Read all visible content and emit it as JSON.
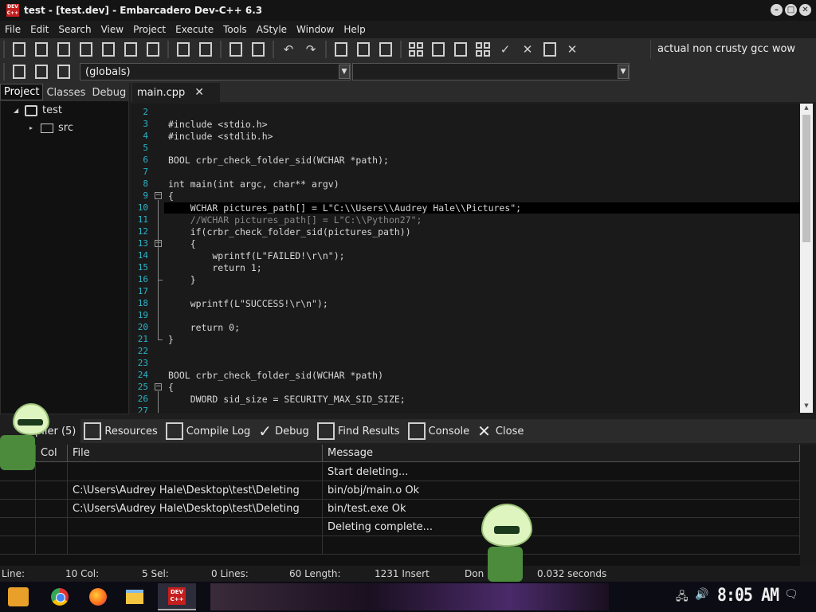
{
  "window": {
    "title": "test - [test.dev] - Embarcadero Dev-C++ 6.3",
    "app_icon_text": "DEV C++",
    "min": "–",
    "max": "□",
    "close": "✕"
  },
  "menu": [
    "File",
    "Edit",
    "Search",
    "View",
    "Project",
    "Execute",
    "Tools",
    "AStyle",
    "Window",
    "Help"
  ],
  "toolbar": {
    "compiler": "actual non crusty gcc wow",
    "scope_combo": "(globals)",
    "undo_glyph": "↶",
    "redo_glyph": "↷",
    "check_glyph": "✓",
    "cross_glyph": "✕"
  },
  "left_panel": {
    "tabs": [
      "Project",
      "Classes",
      "Debug"
    ],
    "tree": [
      {
        "label": "test",
        "toggle": "◢",
        "icon": "project-icon"
      },
      {
        "label": "src",
        "toggle": "▸",
        "icon": "folder-icon"
      }
    ]
  },
  "editor": {
    "tab_label": "main.cpp",
    "tab_close": "✕",
    "lines": [
      {
        "no": "2",
        "text": ""
      },
      {
        "no": "3",
        "text": "#include <stdio.h>"
      },
      {
        "no": "4",
        "text": "#include <stdlib.h>"
      },
      {
        "no": "5",
        "text": ""
      },
      {
        "no": "6",
        "text": "BOOL crbr_check_folder_sid(WCHAR *path);"
      },
      {
        "no": "7",
        "text": ""
      },
      {
        "no": "8",
        "text": "int main(int argc, char** argv)"
      },
      {
        "no": "9",
        "text": "{"
      },
      {
        "no": "10",
        "text": "    WCHAR pictures_path[] = L\"C:\\\\Users\\\\Audrey Hale\\\\Pictures\";"
      },
      {
        "no": "11",
        "text": "    //WCHAR pictures_path[] = L\"C:\\\\Python27\";"
      },
      {
        "no": "12",
        "text": "    if(crbr_check_folder_sid(pictures_path))"
      },
      {
        "no": "13",
        "text": "    {"
      },
      {
        "no": "14",
        "text": "        wprintf(L\"FAILED!\\r\\n\");"
      },
      {
        "no": "15",
        "text": "        return 1;"
      },
      {
        "no": "16",
        "text": "    }"
      },
      {
        "no": "17",
        "text": ""
      },
      {
        "no": "18",
        "text": "    wprintf(L\"SUCCESS!\\r\\n\");"
      },
      {
        "no": "19",
        "text": ""
      },
      {
        "no": "20",
        "text": "    return 0;"
      },
      {
        "no": "21",
        "text": "}"
      },
      {
        "no": "22",
        "text": ""
      },
      {
        "no": "23",
        "text": ""
      },
      {
        "no": "24",
        "text": "BOOL crbr_check_folder_sid(WCHAR *path)"
      },
      {
        "no": "25",
        "text": "{"
      },
      {
        "no": "26",
        "text": "    DWORD sid_size = SECURITY_MAX_SID_SIZE;"
      },
      {
        "no": "27",
        "text": ""
      }
    ],
    "fold_marker": "−"
  },
  "bottom_tabs": [
    "piler (5)",
    "Resources",
    "Compile Log",
    "Debug",
    "Find Results",
    "Console",
    "Close"
  ],
  "messages": {
    "headers": [
      "Col",
      "File",
      "Message"
    ],
    "rows": [
      {
        "file": "",
        "message": "Start deleting..."
      },
      {
        "file": "C:\\Users\\Audrey Hale\\Desktop\\test\\Deleting",
        "message": "bin/obj/main.o Ok"
      },
      {
        "file": "C:\\Users\\Audrey Hale\\Desktop\\test\\Deleting",
        "message": "bin/test.exe Ok"
      },
      {
        "file": "",
        "message": "Deleting complete..."
      }
    ]
  },
  "status": {
    "line_label": "Line:",
    "col_label": "10 Col:",
    "sel_label": "5 Sel:",
    "lines_label": "0 Lines:",
    "length_label": "60 Length:",
    "insert_label": "1231 Insert",
    "done_label": "Don",
    "time": "0.032 seconds"
  },
  "taskbar": {
    "clock": "8:05 AM",
    "devcpp_icon": "DEV C++",
    "tray_network": "🖧",
    "tray_volume": "🔊",
    "tray_notify": "🗨"
  }
}
